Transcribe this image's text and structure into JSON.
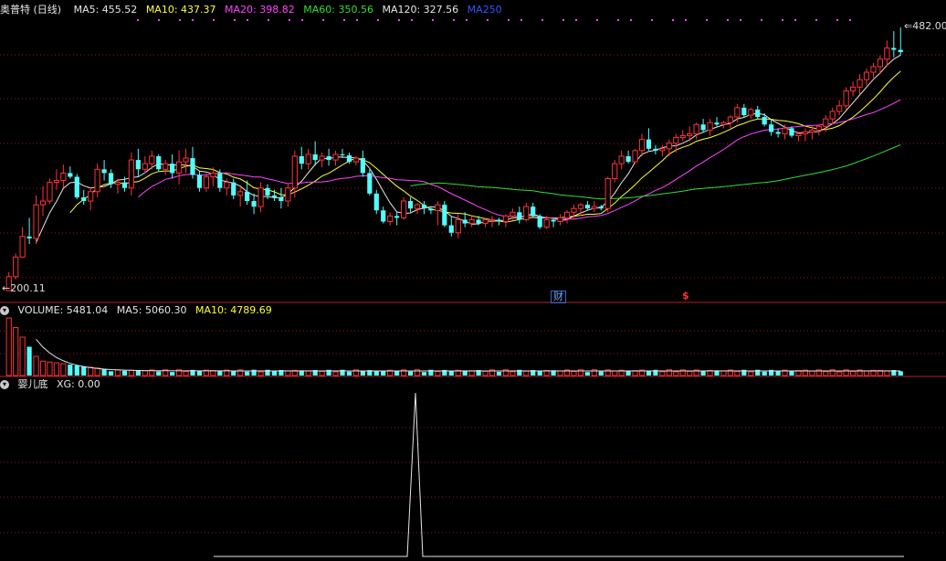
{
  "main_panel": {
    "title": "奥普特 (日线)",
    "ma_labels": [
      {
        "text": "MA5: 455.52",
        "color": "#e6e6e6"
      },
      {
        "text": "MA10: 437.37",
        "color": "#ffff33"
      },
      {
        "text": "MA20: 398.82",
        "color": "#ff44ff"
      },
      {
        "text": "MA60: 350.56",
        "color": "#33dd33"
      },
      {
        "text": "MA120: 327.56",
        "color": "#e6e6e6"
      },
      {
        "text": "MA250",
        "color": "#3355ff"
      }
    ],
    "high_label": "482.00",
    "low_label": "200.11",
    "markers": {
      "cai": "财",
      "dollar": "$"
    }
  },
  "volume_panel": {
    "labels": [
      {
        "text": "VOLUME: 5481.04",
        "color": "#e6e6e6"
      },
      {
        "text": "MA5: 5060.30",
        "color": "#e6e6e6"
      },
      {
        "text": "MA10: 4789.69",
        "color": "#ffff33"
      }
    ]
  },
  "indicator_panel": {
    "labels": [
      {
        "text": "婴儿底",
        "color": "#e6e6e6"
      },
      {
        "text": "XG: 0.00",
        "color": "#e6e6e6"
      }
    ]
  },
  "colors": {
    "up": "#ff3333",
    "down": "#54fcfc",
    "grid": "#8b1a1a",
    "panel_line": "#b22222",
    "ma5": "#e6e6e6",
    "ma10": "#ffff33",
    "ma20": "#ff44ff",
    "ma60": "#33dd33",
    "ma250": "#3355ff"
  },
  "chart_data": {
    "type": "candlestick",
    "y_range": [
      200.11,
      482.0
    ],
    "candles": [
      [
        200,
        200.11,
        220,
        215
      ],
      [
        215,
        212,
        240,
        236
      ],
      [
        236,
        235,
        268,
        258
      ],
      [
        258,
        250,
        278,
        256
      ],
      [
        256,
        250,
        302,
        292
      ],
      [
        292,
        280,
        312,
        296
      ],
      [
        296,
        293,
        320,
        316
      ],
      [
        316,
        308,
        330,
        318
      ],
      [
        318,
        310,
        335,
        326
      ],
      [
        326,
        320,
        333,
        322
      ],
      [
        322,
        298,
        325,
        300
      ],
      [
        300,
        292,
        308,
        296
      ],
      [
        296,
        286,
        310,
        306
      ],
      [
        306,
        300,
        336,
        330
      ],
      [
        330,
        318,
        340,
        326
      ],
      [
        326,
        310,
        330,
        314
      ],
      [
        314,
        304,
        320,
        316
      ],
      [
        316,
        306,
        322,
        310
      ],
      [
        310,
        302,
        348,
        340
      ],
      [
        340,
        322,
        352,
        330
      ],
      [
        330,
        326,
        344,
        336
      ],
      [
        336,
        330,
        350,
        344
      ],
      [
        344,
        328,
        346,
        330
      ],
      [
        330,
        324,
        340,
        336
      ],
      [
        336,
        320,
        346,
        326
      ],
      [
        326,
        314,
        350,
        338
      ],
      [
        338,
        326,
        352,
        342
      ],
      [
        342,
        320,
        354,
        324
      ],
      [
        324,
        306,
        328,
        310
      ],
      [
        310,
        306,
        326,
        322
      ],
      [
        322,
        312,
        332,
        326
      ],
      [
        326,
        306,
        330,
        310
      ],
      [
        310,
        302,
        320,
        316
      ],
      [
        316,
        298,
        320,
        302
      ],
      [
        302,
        290,
        312,
        306
      ],
      [
        306,
        292,
        318,
        296
      ],
      [
        296,
        282,
        304,
        290
      ],
      [
        290,
        284,
        316,
        310
      ],
      [
        310,
        298,
        314,
        302
      ],
      [
        302,
        296,
        308,
        300
      ],
      [
        300,
        288,
        310,
        296
      ],
      [
        296,
        290,
        314,
        310
      ],
      [
        310,
        300,
        350,
        344
      ],
      [
        344,
        330,
        354,
        336
      ],
      [
        336,
        330,
        352,
        346
      ],
      [
        346,
        334,
        360,
        340
      ],
      [
        340,
        332,
        348,
        344
      ],
      [
        344,
        334,
        352,
        340
      ],
      [
        340,
        334,
        350,
        346
      ],
      [
        346,
        342,
        352,
        345
      ],
      [
        345,
        336,
        348,
        338
      ],
      [
        338,
        334,
        344,
        342
      ],
      [
        342,
        322,
        350,
        326
      ],
      [
        326,
        302,
        330,
        304
      ],
      [
        304,
        282,
        308,
        286
      ],
      [
        286,
        272,
        290,
        274
      ],
      [
        274,
        270,
        284,
        280
      ],
      [
        280,
        270,
        284,
        278
      ],
      [
        278,
        276,
        300,
        296
      ],
      [
        296,
        284,
        300,
        288
      ],
      [
        288,
        282,
        294,
        292
      ],
      [
        292,
        282,
        296,
        288
      ],
      [
        288,
        282,
        290,
        286
      ],
      [
        286,
        270,
        296,
        292
      ],
      [
        292,
        268,
        296,
        270
      ],
      [
        270,
        258,
        280,
        262
      ],
      [
        262,
        256,
        282,
        276
      ],
      [
        276,
        268,
        284,
        272
      ],
      [
        272,
        268,
        280,
        276
      ],
      [
        276,
        270,
        280,
        272
      ],
      [
        272,
        268,
        278,
        276
      ],
      [
        276,
        268,
        280,
        276
      ],
      [
        276,
        270,
        278,
        274
      ],
      [
        274,
        268,
        282,
        280
      ],
      [
        280,
        276,
        288,
        284
      ],
      [
        284,
        272,
        290,
        276
      ],
      [
        276,
        274,
        294,
        290
      ],
      [
        290,
        278,
        294,
        280
      ],
      [
        280,
        266,
        282,
        268
      ],
      [
        268,
        266,
        280,
        276
      ],
      [
        276,
        268,
        278,
        274
      ],
      [
        274,
        270,
        282,
        278
      ],
      [
        278,
        272,
        286,
        284
      ],
      [
        284,
        276,
        292,
        288
      ],
      [
        288,
        280,
        294,
        292
      ],
      [
        292,
        286,
        296,
        288
      ],
      [
        288,
        284,
        296,
        290
      ],
      [
        290,
        286,
        292,
        288
      ],
      [
        288,
        284,
        322,
        320
      ],
      [
        320,
        316,
        340,
        336
      ],
      [
        336,
        330,
        350,
        344
      ],
      [
        344,
        336,
        350,
        338
      ],
      [
        338,
        336,
        352,
        350
      ],
      [
        350,
        344,
        368,
        362
      ],
      [
        362,
        350,
        374,
        352
      ],
      [
        352,
        346,
        356,
        350
      ],
      [
        350,
        344,
        356,
        352
      ],
      [
        352,
        344,
        362,
        358
      ],
      [
        358,
        348,
        368,
        364
      ],
      [
        364,
        360,
        372,
        366
      ],
      [
        366,
        360,
        376,
        368
      ],
      [
        368,
        362,
        380,
        378
      ],
      [
        378,
        370,
        384,
        372
      ],
      [
        372,
        366,
        384,
        380
      ],
      [
        380,
        376,
        386,
        378
      ],
      [
        378,
        374,
        382,
        380
      ],
      [
        380,
        374,
        388,
        386
      ],
      [
        386,
        380,
        400,
        396
      ],
      [
        396,
        386,
        400,
        388
      ],
      [
        388,
        384,
        396,
        394
      ],
      [
        394,
        384,
        398,
        386
      ],
      [
        386,
        376,
        390,
        378
      ],
      [
        378,
        366,
        384,
        370
      ],
      [
        370,
        364,
        374,
        368
      ],
      [
        368,
        362,
        378,
        374
      ],
      [
        374,
        364,
        376,
        366
      ],
      [
        366,
        360,
        370,
        368
      ],
      [
        368,
        360,
        374,
        370
      ],
      [
        370,
        362,
        376,
        372
      ],
      [
        372,
        366,
        378,
        376
      ],
      [
        376,
        370,
        388,
        384
      ],
      [
        384,
        378,
        396,
        392
      ],
      [
        392,
        388,
        404,
        398
      ],
      [
        398,
        394,
        418,
        414
      ],
      [
        414,
        408,
        424,
        418
      ],
      [
        418,
        410,
        432,
        426
      ],
      [
        426,
        420,
        438,
        434
      ],
      [
        434,
        428,
        444,
        440
      ],
      [
        440,
        432,
        452,
        448
      ],
      [
        448,
        440,
        468,
        460
      ],
      [
        460,
        450,
        478,
        458
      ],
      [
        458,
        452,
        482,
        455.5
      ]
    ],
    "volume": {
      "ma5": 5060.3,
      "ma10": 4789.69,
      "last": 5481.04
    },
    "indicator": {
      "name": "婴儿底",
      "xg": 0.0
    }
  }
}
